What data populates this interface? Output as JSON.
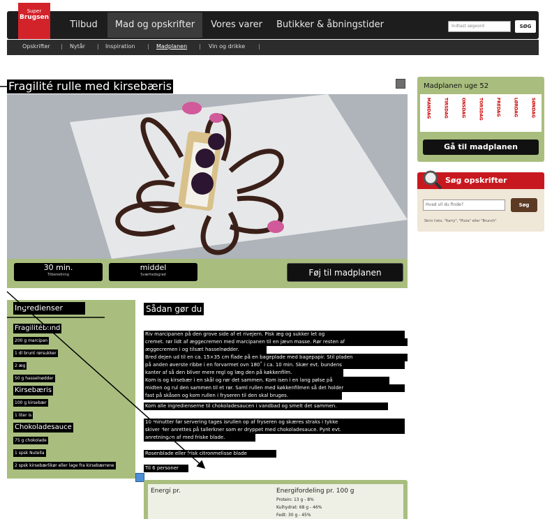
{
  "logo": {
    "line1": "Super",
    "line2": "Brugsen"
  },
  "nav": {
    "tabs": [
      {
        "label": "Tilbud"
      },
      {
        "label": "Mad og opskrifter"
      },
      {
        "label": "Vores varer"
      },
      {
        "label": "Butikker & åbningstider"
      }
    ],
    "search_placeholder": "Indtast søgeord",
    "search_button": "SØG"
  },
  "subnav": {
    "items": [
      "Opskrifter",
      "Nytår",
      "Inspiration",
      "Madplanen",
      "Vin og drikke"
    ]
  },
  "recipe": {
    "title": "Fragilité rulle med kirsebæris",
    "time": "30 min.",
    "time_caption": "Tilberedning",
    "difficulty": "middel",
    "difficulty_caption": "Sværhedsgrad",
    "add_button": "Føj til madplanen"
  },
  "plan": {
    "title": "Madplanen uge 52",
    "days": [
      "MANDAG",
      "TIRSDAG",
      "ONSDAG",
      "TORSDAG",
      "FREDAG",
      "LØRDAG",
      "SØNDAG"
    ],
    "goto_button": "Gå til madplanen"
  },
  "search": {
    "title": "Søg opskrifter",
    "placeholder": "Hvad vil du finde?",
    "button": "Søg",
    "hint": "Skriv f.eks. \"Karry\", \"Pizza\" eller \"Brunch\""
  },
  "ingredients": {
    "title": "Ingredienser",
    "groups": [
      {
        "name": "Fragilitébund",
        "items": [
          "200 g marcipan",
          "1 dl brunt rørsukker",
          "2 æg",
          "50 g hasselnødder"
        ]
      },
      {
        "name": "Kirsebæris",
        "items": [
          "100 g kirsebær",
          "1 liter is"
        ]
      },
      {
        "name": "Chokoladesauce",
        "items": [
          "75 g chokolade",
          "1 spsk Nutella",
          "2 spsk kirsebærlikør eller lage fra kirsebærrene"
        ]
      }
    ]
  },
  "method": {
    "title": "Sådan gør du",
    "lines": [
      "Riv marcipanen på den grove side af et rivejern. Pisk æg og sukker let og",
      "cremet. rør lidt af æggecremen med marcipanen til en jævn masse. Rør resten af",
      "æggecremen i og tilsæt hasselnødder.",
      "Bred dejen ud til en ca. 15×35 cm flade på en bageplade med bagepapir. Stil pladen",
      "på anden øverste ribbe i en forvarmet ovn 180˚ i ca. 10 min. Skær evt. bundens",
      "kanter af så den bliver mere regl og læg den på køkkenfilm.",
      "Kom is og kirsebær i en skål og rør det sammen. Kom isen i en lang pølse på",
      "midten og rul den sammen til et rør. Saml rullen med køkkenfilmen så det holder",
      "fast på skåsen og kom rullen i fryseren til den skal bruges.",
      "Kom alle ingredienserne til chokoladesaucen i vandbad og smelt det sammen.",
      "10 minutter før servering tages isrullen op af fryseren og skæres straks i tykke",
      "skiver der anrettes på tallerkner som er dryppet med chokoladesauce. Pynt evt.",
      "anretningen af med friske blade.",
      "Rosenblade eller frisk citronmelisse blade",
      "Til 6 personer"
    ]
  },
  "nutrition": {
    "energy_label": "Energi pr.",
    "dist_label": "Energifordeling pr. 100 g",
    "lines": [
      "Protein: 13 g - 8%",
      "Kulhydrat: 68 g - 46%",
      "Fedt: 30 g - 45%"
    ]
  },
  "colors": {
    "brand_red": "#d2232a",
    "accent_green": "#a9be7e",
    "nav_dark": "#1d1d1d"
  }
}
